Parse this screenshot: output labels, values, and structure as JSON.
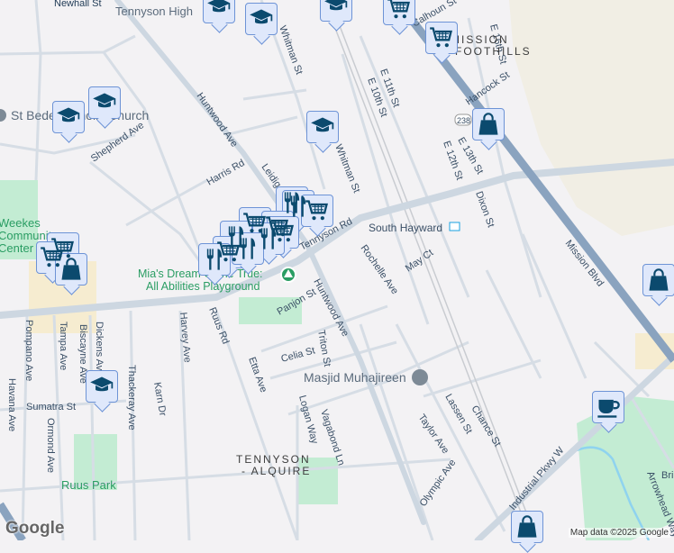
{
  "map": {
    "streets": [
      "Newhall St",
      "Tennyson High",
      "Whitman St",
      "Calhoun St",
      "E 16th St",
      "E 11th St",
      "E 10th St",
      "Hancock St",
      "E 13th St",
      "E 12th St",
      "Dixon St",
      "Huntwood Ave",
      "Shepherd Ave",
      "Harris Rd",
      "Leidig Ct",
      "Whitman St",
      "Tennyson Rd",
      "South Hayward",
      "Rochelle Ave",
      "May Ct",
      "Mission Blvd",
      "Panjon St",
      "Huntwood Ave",
      "Ruus Rd",
      "Harvey Ave",
      "Celia St",
      "Triton St",
      "Etta Ave",
      "Pompano Ave",
      "Tampa Ave",
      "Biscayne Ave",
      "Dickens Ave",
      "Thackeray Ave",
      "Karn Dr",
      "Havana Ave",
      "Sumatra St",
      "Ormond Ave",
      "Logan Way",
      "Vagabond Ln",
      "Lassen St",
      "Chance St",
      "Taylor Ave",
      "Olympic Ave",
      "Industrial Pkwy W",
      "Arrowhead Way",
      "Bri",
      "238"
    ],
    "pois": {
      "church": "St Bede Catholic Church",
      "playground_line1": "Mia's Dream Come True:",
      "playground_line2": "All Abilities Playground",
      "mosque": "Masjid Muhajireen",
      "community_park_1": "Weekes",
      "community_park_2": "Community",
      "community_park_3": "Center Park",
      "ruus_park": "Ruus Park"
    },
    "areas": {
      "tennyson_1": "TENNYSON",
      "tennyson_2": "- ALQUIRE",
      "mission_1": "MISSION",
      "mission_2": "FOOTHILLS"
    },
    "colors": {
      "pin_fill": "#dfe8fb",
      "pin_border": "#6d93d6",
      "icon": "#0b4a6e",
      "highway": "#8aa3bf",
      "park": "#c3ecd3",
      "hills": "#f1eee4"
    }
  },
  "attribution": "Map data ©2025 Google",
  "logo": "Google"
}
